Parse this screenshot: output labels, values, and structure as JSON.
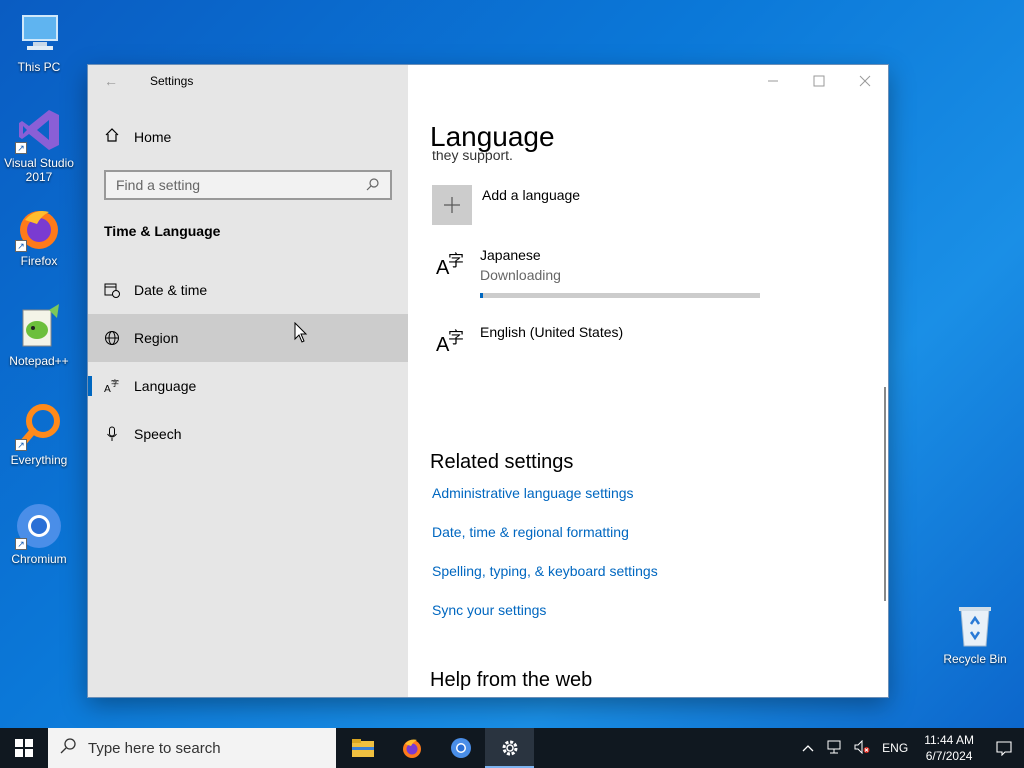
{
  "desktop": {
    "icons": [
      {
        "label": "This PC"
      },
      {
        "label": "Visual Studio 2017"
      },
      {
        "label": "Firefox"
      },
      {
        "label": "Notepad++"
      },
      {
        "label": "Everything"
      },
      {
        "label": "Chromium"
      },
      {
        "label": "Recycle Bin"
      }
    ]
  },
  "window": {
    "title": "Settings",
    "sidebar": {
      "home_label": "Home",
      "search_placeholder": "Find a setting",
      "section_title": "Time & Language",
      "items": [
        {
          "label": "Date & time",
          "icon": "calendar-clock-icon"
        },
        {
          "label": "Region",
          "icon": "globe-icon"
        },
        {
          "label": "Language",
          "icon": "language-icon"
        },
        {
          "label": "Speech",
          "icon": "microphone-icon"
        }
      ],
      "selected": "Language",
      "hovered": "Region"
    },
    "main": {
      "page_title": "Language",
      "cut_text": "they support.",
      "add_language_label": "Add a language",
      "languages": [
        {
          "name": "Japanese",
          "status": "Downloading",
          "progress": 0.01
        },
        {
          "name": "English (United States)",
          "status": ""
        }
      ],
      "related_title": "Related settings",
      "related_links": [
        "Administrative language settings",
        "Date, time & regional formatting",
        "Spelling, typing, & keyboard settings",
        "Sync your settings"
      ],
      "help_title": "Help from the web"
    }
  },
  "taskbar": {
    "search_placeholder": "Type here to search",
    "apps": [
      "file-explorer-icon",
      "firefox-icon",
      "chromium-icon",
      "settings-icon"
    ],
    "active_app": "settings-icon",
    "tray": {
      "language": "ENG",
      "time": "11:44 AM",
      "date": "6/7/2024"
    }
  },
  "colors": {
    "accent": "#0067c0",
    "sidebar_bg": "#e6e6e6",
    "hover_bg": "#cccccc",
    "taskbar_bg": "#101820"
  }
}
